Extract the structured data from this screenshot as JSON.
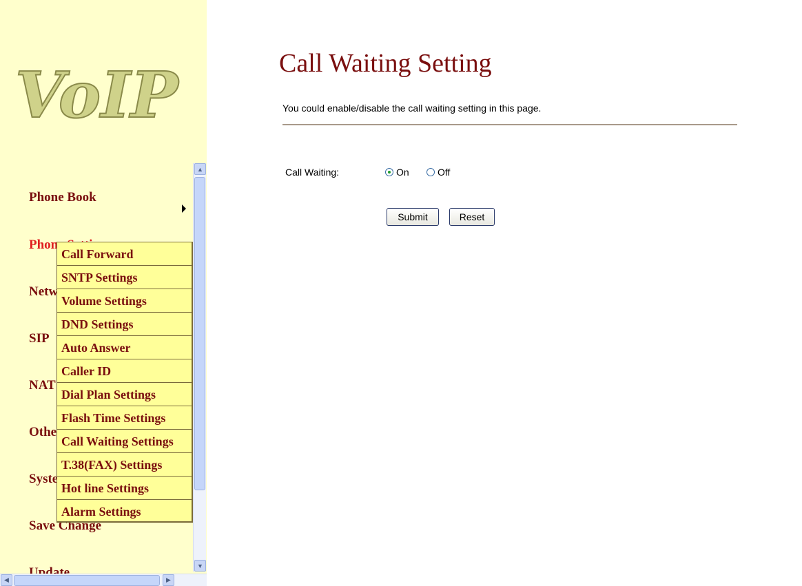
{
  "logo": {
    "text": "VoIP"
  },
  "nav": {
    "items": [
      {
        "label": "Phone Book"
      },
      {
        "label": "Phone Settings"
      },
      {
        "label": "Network"
      },
      {
        "label": "SIP"
      },
      {
        "label": "NAT"
      },
      {
        "label": "Other"
      },
      {
        "label": "System"
      },
      {
        "label": "Save Change"
      },
      {
        "label": "Update"
      }
    ],
    "active": "Phone Settings"
  },
  "submenu": {
    "items": [
      {
        "label": "Call Forward"
      },
      {
        "label": "SNTP Settings"
      },
      {
        "label": "Volume Settings"
      },
      {
        "label": "DND Settings"
      },
      {
        "label": "Auto Answer"
      },
      {
        "label": "Caller ID"
      },
      {
        "label": "Dial Plan Settings"
      },
      {
        "label": "Flash Time Settings"
      },
      {
        "label": "Call Waiting Settings"
      },
      {
        "label": "T.38(FAX) Settings"
      },
      {
        "label": "Hot line Settings"
      },
      {
        "label": "Alarm Settings"
      }
    ]
  },
  "main": {
    "title": "Call Waiting Setting",
    "description": "You could enable/disable the call waiting setting in this page.",
    "call_waiting_label": "Call Waiting:",
    "option_on": "On",
    "option_off": "Off",
    "selected": "On",
    "submit_label": "Submit",
    "reset_label": "Reset"
  },
  "colors": {
    "sidebar_bg": "#ffffcc",
    "submenu_bg": "#ffff99",
    "nav_text": "#7a0f0f",
    "active_text": "#e02020"
  }
}
